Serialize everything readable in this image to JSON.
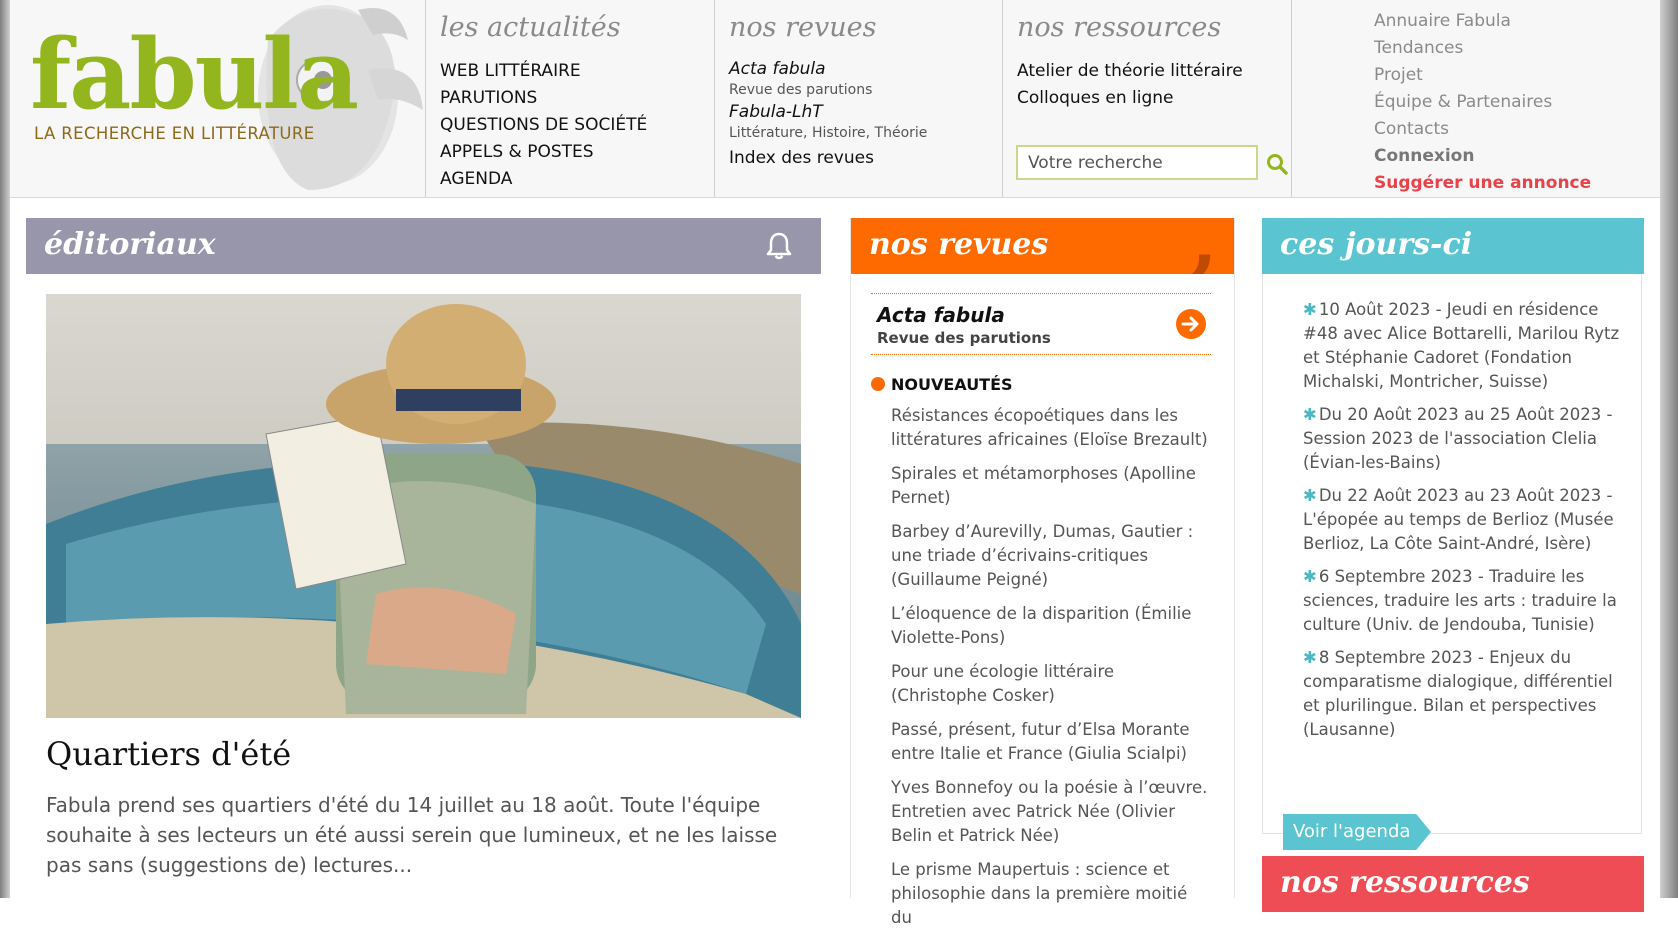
{
  "logo": {
    "word": "fabula",
    "tagline": "LA RECHERCHE EN LITTÉRATURE"
  },
  "nav": {
    "actualites": {
      "heading": "les actualités",
      "items": [
        "WEB LITTÉRAIRE",
        "PARUTIONS",
        "QUESTIONS DE SOCIÉTÉ",
        "APPELS & POSTES",
        "AGENDA"
      ]
    },
    "revues": {
      "heading": "nos revues",
      "acta_title": "Acta fabula",
      "acta_sub": "Revue des parutions",
      "lht_title": "Fabula-LhT",
      "lht_sub": "Littérature, Histoire, Théorie",
      "index": "Index des revues"
    },
    "ressources": {
      "heading": "nos ressources",
      "items": [
        "Atelier de théorie littéraire",
        "Colloques en ligne"
      ]
    },
    "search": {
      "placeholder": "Votre recherche",
      "icon": "search-icon"
    },
    "utility": {
      "links": [
        "Annuaire Fabula",
        "Tendances",
        "Projet",
        "Équipe & Partenaires",
        "Contacts"
      ],
      "login": "Connexion",
      "suggest": "Suggérer une annonce"
    }
  },
  "editoriaux": {
    "heading": "éditoriaux",
    "icon": "bell-icon",
    "title": "Quartiers d'été",
    "text": "Fabula prend ses quartiers d'été du 14 juillet au 18 août. Toute l'équipe souhaite à ses lecteurs un été aussi serein que lumineux, et ne les laisse pas sans (suggestions de) lectures..."
  },
  "revues_block": {
    "heading": "nos revues",
    "feature_title": "Acta fabula",
    "feature_sub": "Revue des parutions",
    "nouveautes_label": "NOUVEAUTÉS",
    "items": [
      "Résistances écopoétiques dans les littératures africaines (Eloïse Brezault)",
      "Spirales et métamorphoses (Apolline Pernet)",
      "Barbey d’Aurevilly, Dumas, Gautier : une triade d’écrivains-critiques (Guillaume Peigné)",
      "L’éloquence de la disparition (Émilie Violette-Pons)",
      "Pour une écologie littéraire (Christophe Cosker)",
      "Passé, présent, futur d’Elsa Morante entre Italie et France (Giulia Scialpi)",
      "Yves Bonnefoy ou la poésie à l’œuvre. Entretien avec Patrick Née (Olivier Belin et Patrick Née)",
      "Le prisme Maupertuis : science et philosophie dans la première moitié du"
    ]
  },
  "jours": {
    "heading": "ces jours-ci",
    "events": [
      "10 Août 2023 - Jeudi en résidence #48 avec Alice Bottarelli, Marilou Rytz et Stéphanie Cadoret (Fondation Michalski, Montricher, Suisse)",
      "Du 20 Août 2023 au 25 Août 2023 - Session 2023 de l'association Clelia (Évian-les-Bains)",
      "Du 22 Août 2023 au 23 Août 2023 - L'épopée au temps de Berlioz (Musée Berlioz, La Côte Saint-André, Isère)",
      "6 Septembre 2023 - Traduire les sciences, traduire les arts : traduire la culture (Univ. de Jendouba, Tunisie)",
      "8 Septembre 2023 - Enjeux du comparatisme dialogique, différentiel et plurilingue. Bilan et perspectives (Lausanne)"
    ],
    "agenda_button": "Voir l'agenda"
  },
  "ressources_block": {
    "heading": "nos ressources"
  },
  "colors": {
    "fabula_green": "#93b51e",
    "editoriaux": "#9796aa",
    "revues": "#fe6a00",
    "jours": "#5ac5d0",
    "ressources": "#ee4d55"
  }
}
